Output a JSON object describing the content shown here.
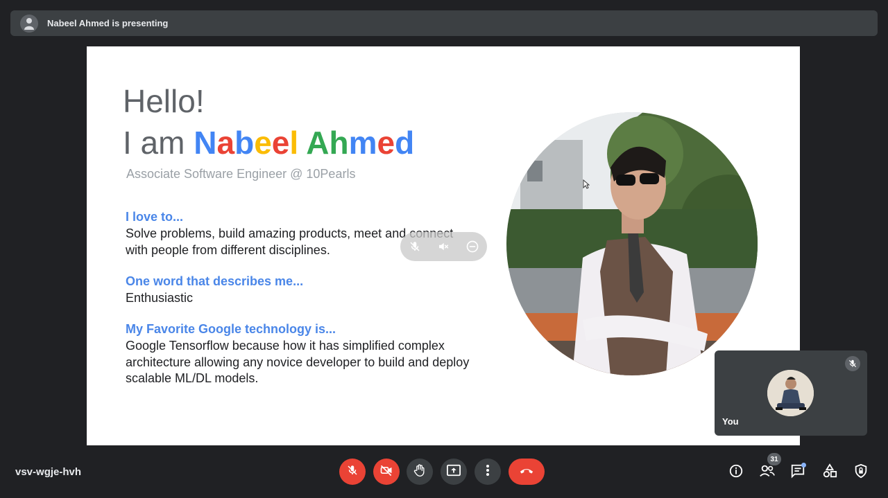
{
  "banner": {
    "presenter_text": "Nabeel Ahmed is presenting"
  },
  "slide": {
    "hello": "Hello!",
    "iam_prefix": "I am ",
    "name_letters": [
      {
        "ch": "N",
        "color": "#4285f4"
      },
      {
        "ch": "a",
        "color": "#ea4335"
      },
      {
        "ch": "b",
        "color": "#4285f4"
      },
      {
        "ch": "e",
        "color": "#fbbc05"
      },
      {
        "ch": "e",
        "color": "#ea4335"
      },
      {
        "ch": "l",
        "color": "#fbbc05"
      },
      {
        "ch": " ",
        "color": "#000000"
      },
      {
        "ch": "A",
        "color": "#34a853"
      },
      {
        "ch": "h",
        "color": "#34a853"
      },
      {
        "ch": "m",
        "color": "#4285f4"
      },
      {
        "ch": "e",
        "color": "#ea4335"
      },
      {
        "ch": "d",
        "color": "#4285f4"
      }
    ],
    "role": "Associate Software Engineer @ 10Pearls",
    "sections": [
      {
        "heading": "I love to...",
        "body": "Solve problems, build amazing products, meet and connect with people from different disciplines."
      },
      {
        "heading": "One word that describes me...",
        "body": "Enthusiastic"
      },
      {
        "heading": "My Favorite Google technology is...",
        "body": "Google Tensorflow because how it has simplified complex architecture allowing any novice developer to build and deploy scalable ML/DL models."
      }
    ]
  },
  "self_tile": {
    "label": "You"
  },
  "footer": {
    "meeting_code": "vsv-wgje-hvh",
    "participants_count": "31"
  },
  "colors": {
    "danger": "#ea4335",
    "accent": "#8ab4f8",
    "heading_blue": "#4a86e8"
  },
  "icons": {
    "controls": [
      "mic-off-icon",
      "camera-off-icon",
      "raise-hand-icon",
      "present-screen-icon",
      "more-options-icon",
      "end-call-icon"
    ],
    "right": [
      "info-icon",
      "people-icon",
      "chat-icon",
      "activities-icon",
      "host-controls-icon"
    ]
  }
}
